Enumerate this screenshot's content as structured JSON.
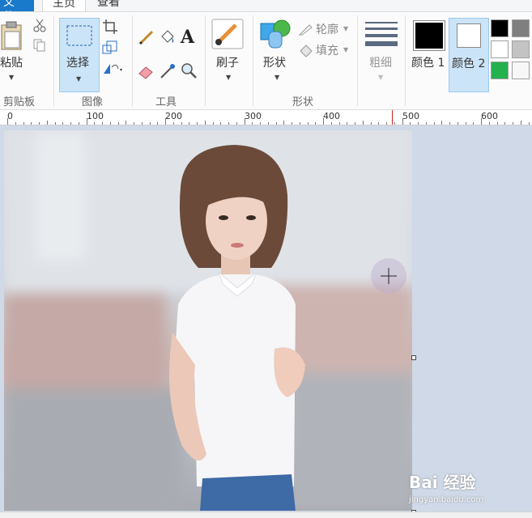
{
  "tabs": {
    "file": "文件",
    "home": "主页",
    "view": "查看"
  },
  "clipboard": {
    "paste_label": "粘贴",
    "group_label": "剪贴板"
  },
  "image": {
    "select_label": "选择",
    "group_label": "图像"
  },
  "tools": {
    "text_icon_label": "A",
    "group_label": "工具"
  },
  "brushes": {
    "label": "刷子"
  },
  "shapes": {
    "label": "形状",
    "outline_label": "轮廓",
    "fill_label": "填充",
    "group_label": "形状"
  },
  "size": {
    "label": "粗细"
  },
  "colors": {
    "color1_label": "颜色 1",
    "color2_label": "颜色 2",
    "color1": "#000000",
    "color2": "#ffffff",
    "palette": [
      "#000000",
      "#7f7f7f",
      "#ffffff",
      "#c3c3c3",
      "#22b14c",
      "#ffffff"
    ]
  },
  "ruler": {
    "labels": [
      "0",
      "100",
      "200",
      "300",
      "400",
      "500",
      "600"
    ]
  },
  "watermark": {
    "brand": "Bai 经验",
    "url": "jingyan.baidu.com"
  }
}
